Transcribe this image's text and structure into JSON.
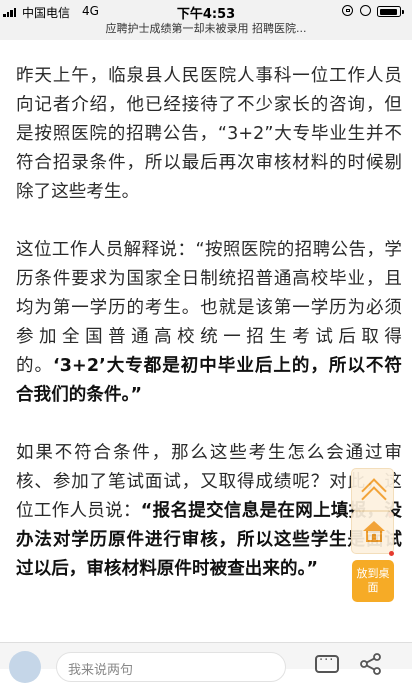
{
  "status_bar": {
    "carrier": "中国电信",
    "network": "4G",
    "time": "下午4:53"
  },
  "title_bar": {
    "title": "应聘护士成绩第一却未被录用 招聘医院..."
  },
  "article": {
    "p1": "昨天上午，临泉县人民医院人事科一位工作人员向记者介绍，他已经接待了不少家长的咨询，但是按照医院的招聘公告，“3+2”大专毕业生并不符合招录条件，所以最后再次审核材料的时候剔除了这些考生。",
    "p2_normal": "这位工作人员解释说：“按照医院的招聘公告，学历条件要求为国家全日制统招普通高校毕业，且均为第一学历的考生。也就是该第一学历为必须参加全国普通高校统一招生考试后取得的。",
    "p2_bold": "‘3+2’大专都是初中毕业后上的，所以不符合我们的条件。”",
    "p3_normal": "如果不符合条件，那么这些考生怎么会通过审核、参加了笔试面试，又取得成绩呢？对此，这位工作人员说：",
    "p3_bold": "“报名提交信息是在网上填报，没办法对学历原件进行审核，所以这些学生是面试过以后，审核材料原件时被查出来的。”"
  },
  "floating": {
    "desktop_label": "放到桌面"
  },
  "bottom_bar": {
    "comment_placeholder": "我来说两句"
  },
  "colors": {
    "accent_orange": "#f6ab26",
    "icon_orange": "#f19c28",
    "notification_red": "#e53a2f"
  }
}
